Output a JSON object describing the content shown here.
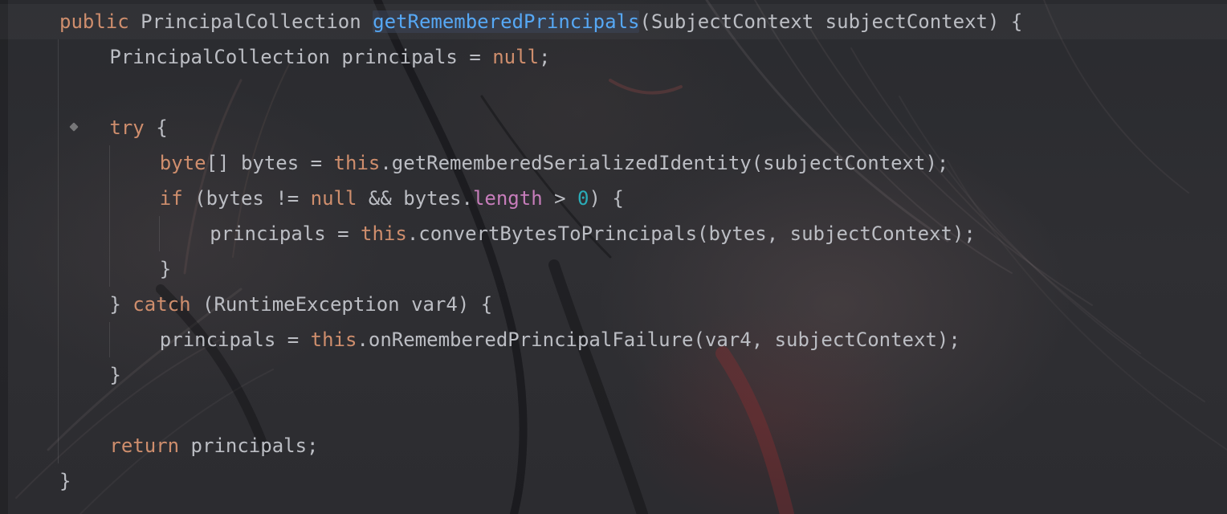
{
  "editor": {
    "lines": [
      {
        "indent": "  ",
        "tokens": [
          {
            "t": "public",
            "c": "kw"
          },
          {
            "t": " PrincipalCollection ",
            "c": "plain"
          },
          {
            "t": "getRememberedPrincipals",
            "c": "mdecl"
          },
          {
            "t": "(SubjectContext subjectContext) {",
            "c": "plain"
          }
        ]
      },
      {
        "indent": "      ",
        "tokens": [
          {
            "t": "PrincipalCollection principals = ",
            "c": "plain"
          },
          {
            "t": "null",
            "c": "kw"
          },
          {
            "t": ";",
            "c": "plain"
          }
        ]
      },
      {
        "indent": "",
        "tokens": []
      },
      {
        "indent": "      ",
        "fold": true,
        "tokens": [
          {
            "t": "try",
            "c": "kw"
          },
          {
            "t": " {",
            "c": "plain"
          }
        ]
      },
      {
        "indent": "          ",
        "tokens": [
          {
            "t": "byte",
            "c": "kw"
          },
          {
            "t": "[] bytes = ",
            "c": "plain"
          },
          {
            "t": "this",
            "c": "kw"
          },
          {
            "t": ".getRememberedSerializedIdentity(subjectContext);",
            "c": "plain"
          }
        ]
      },
      {
        "indent": "          ",
        "tokens": [
          {
            "t": "if",
            "c": "kw"
          },
          {
            "t": " (bytes != ",
            "c": "plain"
          },
          {
            "t": "null",
            "c": "kw"
          },
          {
            "t": " && bytes.",
            "c": "plain"
          },
          {
            "t": "length",
            "c": "fld"
          },
          {
            "t": " > ",
            "c": "plain"
          },
          {
            "t": "0",
            "c": "num"
          },
          {
            "t": ") {",
            "c": "plain"
          }
        ]
      },
      {
        "indent": "              ",
        "tokens": [
          {
            "t": "principals = ",
            "c": "plain"
          },
          {
            "t": "this",
            "c": "kw"
          },
          {
            "t": ".convertBytesToPrincipals(bytes, subjectContext);",
            "c": "plain"
          }
        ]
      },
      {
        "indent": "          ",
        "tokens": [
          {
            "t": "}",
            "c": "plain"
          }
        ]
      },
      {
        "indent": "      ",
        "tokens": [
          {
            "t": "} ",
            "c": "plain"
          },
          {
            "t": "catch",
            "c": "kw"
          },
          {
            "t": " (RuntimeException var4) {",
            "c": "plain"
          }
        ]
      },
      {
        "indent": "          ",
        "tokens": [
          {
            "t": "principals = ",
            "c": "plain"
          },
          {
            "t": "this",
            "c": "kw"
          },
          {
            "t": ".onRememberedPrincipalFailure(var4, subjectContext);",
            "c": "plain"
          }
        ]
      },
      {
        "indent": "      ",
        "tokens": [
          {
            "t": "}",
            "c": "plain"
          }
        ]
      },
      {
        "indent": "",
        "tokens": []
      },
      {
        "indent": "      ",
        "tokens": [
          {
            "t": "return",
            "c": "kw"
          },
          {
            "t": " principals;",
            "c": "plain"
          }
        ]
      },
      {
        "indent": "  ",
        "tokens": [
          {
            "t": "}",
            "c": "plain"
          }
        ]
      }
    ]
  },
  "colors": {
    "keyword": "#cf8e6d",
    "text": "#bcbec4",
    "method_declaration": "#56a8f5",
    "field": "#c77dbb",
    "number": "#2aacb8"
  }
}
